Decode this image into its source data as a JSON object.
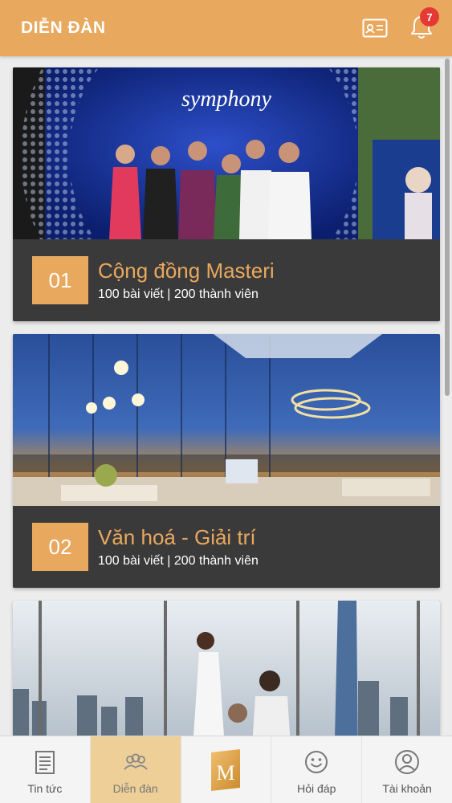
{
  "header": {
    "title": "DIỄN ĐÀN",
    "notification_count": "7",
    "id_card_icon": "id-card-icon",
    "bell_icon": "bell-icon"
  },
  "forums": [
    {
      "number": "01",
      "title": "Cộng đồng Masteri",
      "stats": "100 bài viết | 200 thành viên",
      "image": "event-photo-symphony"
    },
    {
      "number": "02",
      "title": "Văn hoá - Giải trí",
      "stats": "100 bài viết | 200 thành viên",
      "image": "luxury-living-room-city-view"
    },
    {
      "number": "",
      "title": "",
      "stats": "",
      "image": "family-in-apartment-skyline"
    }
  ],
  "bottom_nav": [
    {
      "label": "Tin tức",
      "icon": "news-icon",
      "active": false
    },
    {
      "label": "Diễn đàn",
      "icon": "forum-icon",
      "active": true
    },
    {
      "label": "",
      "icon": "masteri-logo-icon",
      "active": false
    },
    {
      "label": "Hỏi đáp",
      "icon": "smiley-icon",
      "active": false
    },
    {
      "label": "Tài khoản",
      "icon": "account-icon",
      "active": false
    }
  ],
  "colors": {
    "accent": "#e8a85e",
    "card_footer": "#3b3a3a",
    "badge": "#e53935",
    "nav_active": "#eecf97"
  }
}
